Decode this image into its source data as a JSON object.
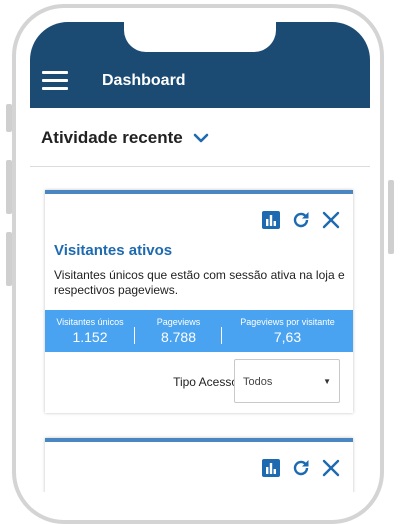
{
  "header": {
    "title": "Dashboard"
  },
  "section": {
    "title": "Atividade recente"
  },
  "cards": [
    {
      "title": "Visitantes ativos",
      "description": "Visitantes únicos que estão com sessão ativa na loja e respectivos pageviews.",
      "stats": [
        {
          "label": "Visitantes únicos",
          "value": "1.152"
        },
        {
          "label": "Pageviews",
          "value": "8.788"
        },
        {
          "label": "Pageviews por visitante",
          "value": "7,63"
        }
      ],
      "filter": {
        "label": "Tipo Acesso",
        "value": "Todos"
      }
    }
  ],
  "colors": {
    "header_bg": "#1b4a73",
    "card_accent": "#4a86c0",
    "title_blue": "#1e6ab0",
    "stats_bg": "#4aa3f0"
  },
  "icons": [
    "menu-icon",
    "chevron-down-icon",
    "bar-chart-icon",
    "refresh-icon",
    "close-icon",
    "select-arrow-icon"
  ]
}
